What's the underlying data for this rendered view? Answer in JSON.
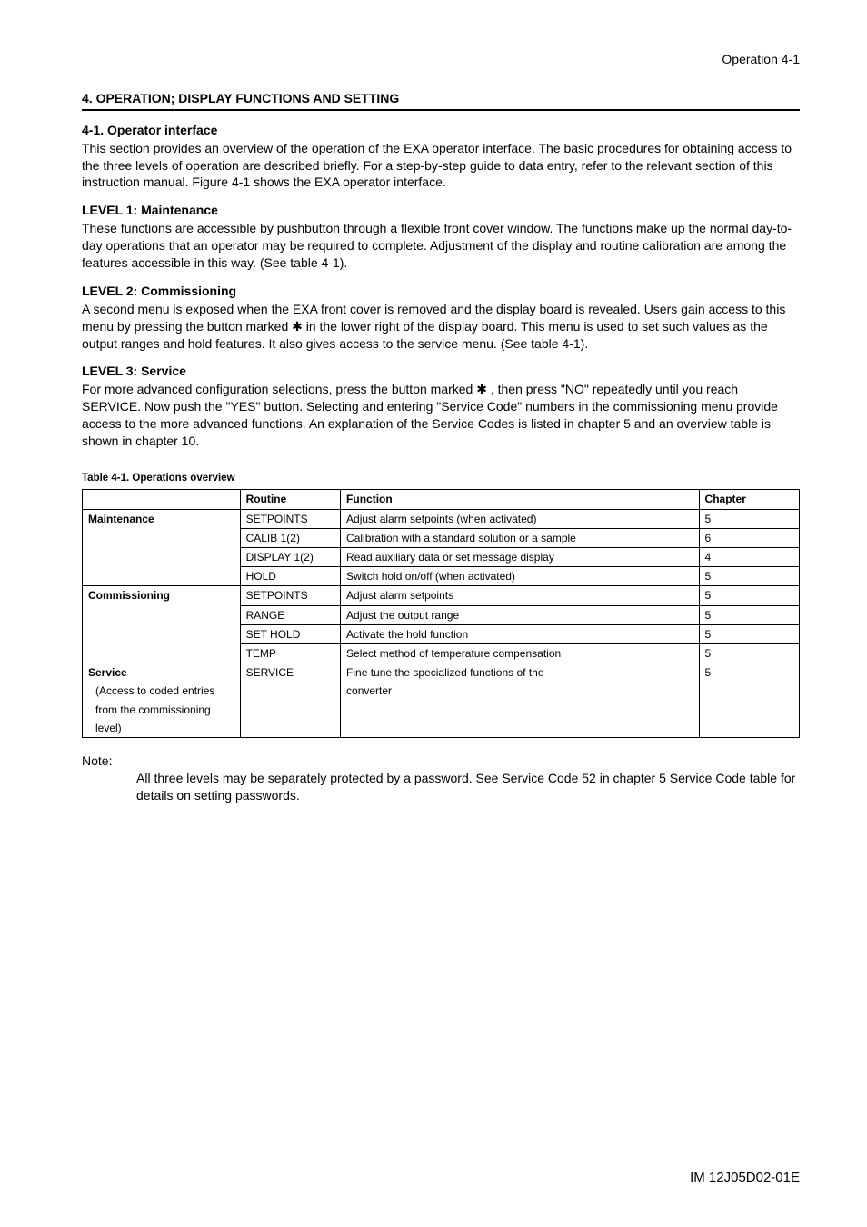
{
  "header": {
    "page_label": "Operation 4-1"
  },
  "title": "4. OPERATION; DISPLAY FUNCTIONS AND SETTING",
  "s1": {
    "heading": "4-1. Operator interface",
    "text": "This section provides an overview of the operation of the EXA operator interface. The basic procedures for obtaining access to the three levels of operation are described briefly. For a step-by-step guide to data entry, refer to the relevant section of this instruction manual. Figure 4-1 shows the EXA operator interface."
  },
  "l1": {
    "heading": "LEVEL 1: Maintenance",
    "text": "These functions are accessible by pushbutton through a flexible front cover window. The functions make up the normal day-to-day operations that an operator may be required to complete. Adjustment of the display and routine calibration are among the features accessible in this way. (See table 4-1)."
  },
  "l2": {
    "heading": "LEVEL 2: Commissioning",
    "text": "A second menu is exposed when the EXA front cover is removed and the display board is revealed. Users gain access to this menu by pressing the button marked ✱ in the lower right of the display board. This menu is used to set such values as the output ranges and hold features. It also gives access to the service menu. (See table 4-1)."
  },
  "l3": {
    "heading": "LEVEL 3: Service",
    "text": "For more advanced configuration selections, press the button marked ✱ , then press \"NO\" repeatedly until you reach SERVICE. Now push the \"YES\" button. Selecting and entering \"Service Code\" numbers  in the commissioning menu provide access to the more advanced functions. An explanation of the Service Codes is listed in chapter 5 and an overview table is shown in chapter 10."
  },
  "table": {
    "caption": "Table 4-1. Operations overview",
    "head": {
      "c1": "",
      "c2": "Routine",
      "c3": "Function",
      "c4": "Chapter"
    },
    "rows": [
      {
        "level": "Maintenance",
        "routine": "SETPOINTS",
        "func": "Adjust alarm setpoints (when activated)",
        "chap": "5"
      },
      {
        "level": "",
        "routine": "CALIB 1(2)",
        "func": "Calibration with a standard solution or a sample",
        "chap": "6"
      },
      {
        "level": "",
        "routine": "DISPLAY 1(2)",
        "func": "Read auxiliary data or set message display",
        "chap": "4"
      },
      {
        "level": "",
        "routine": "HOLD",
        "func": "Switch hold on/off (when activated)",
        "chap": "5"
      },
      {
        "level": "Commissioning",
        "routine": "SETPOINTS",
        "func": "Adjust alarm setpoints",
        "chap": "5"
      },
      {
        "level": "",
        "routine": "RANGE",
        "func": "Adjust the output range",
        "chap": "5"
      },
      {
        "level": "",
        "routine": "SET HOLD",
        "func": "Activate the hold function",
        "chap": "5"
      },
      {
        "level": "",
        "routine": "TEMP",
        "func": "Select method of temperature compensation",
        "chap": "5"
      },
      {
        "level": "Service",
        "routine": "SERVICE",
        "func": "Fine tune the specialized functions of the",
        "chap": "5"
      },
      {
        "level_sub": "(Access to coded entries",
        "routine": "",
        "func": "converter",
        "chap": ""
      },
      {
        "level_sub": "from the commissioning",
        "routine": "",
        "func": "",
        "chap": ""
      },
      {
        "level_sub": "level)",
        "routine": "",
        "func": "",
        "chap": ""
      }
    ]
  },
  "note": {
    "label": "Note:",
    "text": "All three levels may be separately protected by a password. See Service Code 52 in chapter 5 Service Code table for details on setting passwords."
  },
  "footer": {
    "doc_id": "IM 12J05D02-01E"
  }
}
